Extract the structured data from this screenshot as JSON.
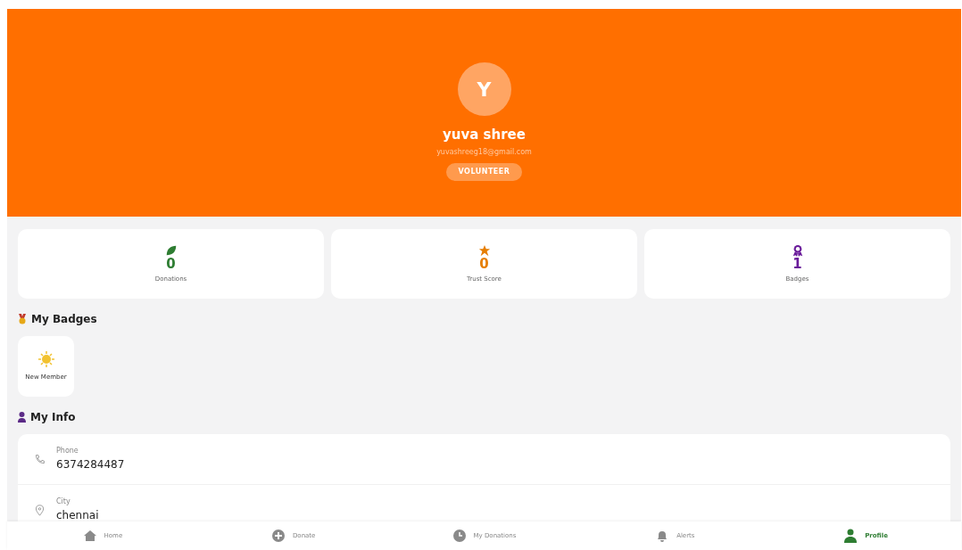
{
  "profile": {
    "initial": "Y",
    "name": "yuva shree",
    "email": "yuvashreeg18@gmail.com",
    "role": "VOLUNTEER"
  },
  "stats": [
    {
      "value": "0",
      "label": "Donations",
      "color": "#2e7d32"
    },
    {
      "value": "0",
      "label": "Trust Score",
      "color": "#e67e00"
    },
    {
      "value": "1",
      "label": "Badges",
      "color": "#6a1b9a"
    }
  ],
  "badges_section": {
    "title": "My Badges",
    "badges": [
      {
        "label": "New Member"
      }
    ]
  },
  "info_section": {
    "title": "My Info",
    "items": [
      {
        "label": "Phone",
        "value": "6374284487"
      },
      {
        "label": "City",
        "value": "chennai"
      }
    ]
  },
  "nav": [
    {
      "label": "Home",
      "selected": false
    },
    {
      "label": "Donate",
      "selected": false
    },
    {
      "label": "My Donations",
      "selected": false
    },
    {
      "label": "Alerts",
      "selected": false
    },
    {
      "label": "Profile",
      "selected": true
    }
  ]
}
